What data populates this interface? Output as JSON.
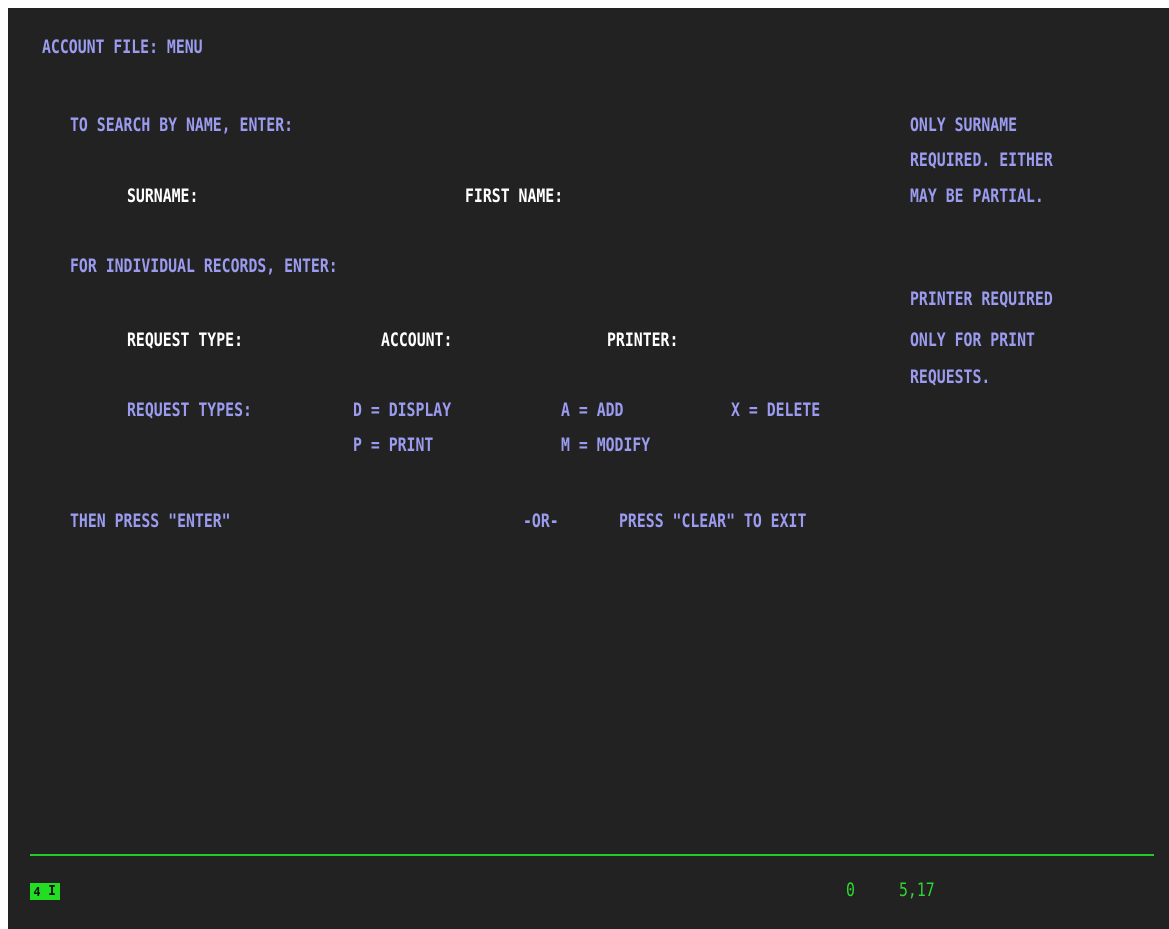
{
  "screen": {
    "title": "ACCOUNT FILE: MENU",
    "search_heading": "TO SEARCH BY NAME, ENTER:",
    "search_note": [
      "ONLY SURNAME",
      "REQUIRED. EITHER",
      "MAY BE PARTIAL."
    ],
    "surname_label": "SURNAME:",
    "first_name_label": "FIRST NAME:",
    "individual_heading": "FOR INDIVIDUAL RECORDS, ENTER:",
    "printer_note": [
      "PRINTER REQUIRED",
      "ONLY FOR PRINT",
      "REQUESTS."
    ],
    "request_type_label": "REQUEST TYPE:",
    "account_label": "ACCOUNT:",
    "printer_label": "PRINTER:",
    "request_types_label": "REQUEST TYPES:",
    "request_types": {
      "display": "D = DISPLAY",
      "add": "A = ADD",
      "delete": "X = DELETE",
      "print": "P = PRINT",
      "modify": "M = MODIFY"
    },
    "then_press": "THEN PRESS \"ENTER\"",
    "or_text": "-OR-",
    "clear_text": "PRESS \"CLEAR\" TO EXIT"
  },
  "status_bar": {
    "indicator_1": "4",
    "indicator_2": "I",
    "message_count": "0",
    "cursor_position": "5,17"
  },
  "colors": {
    "background": "#222222",
    "protected_text": "#9b9bf0",
    "label_text": "#ffffff",
    "status_text": "#2fd62f"
  }
}
